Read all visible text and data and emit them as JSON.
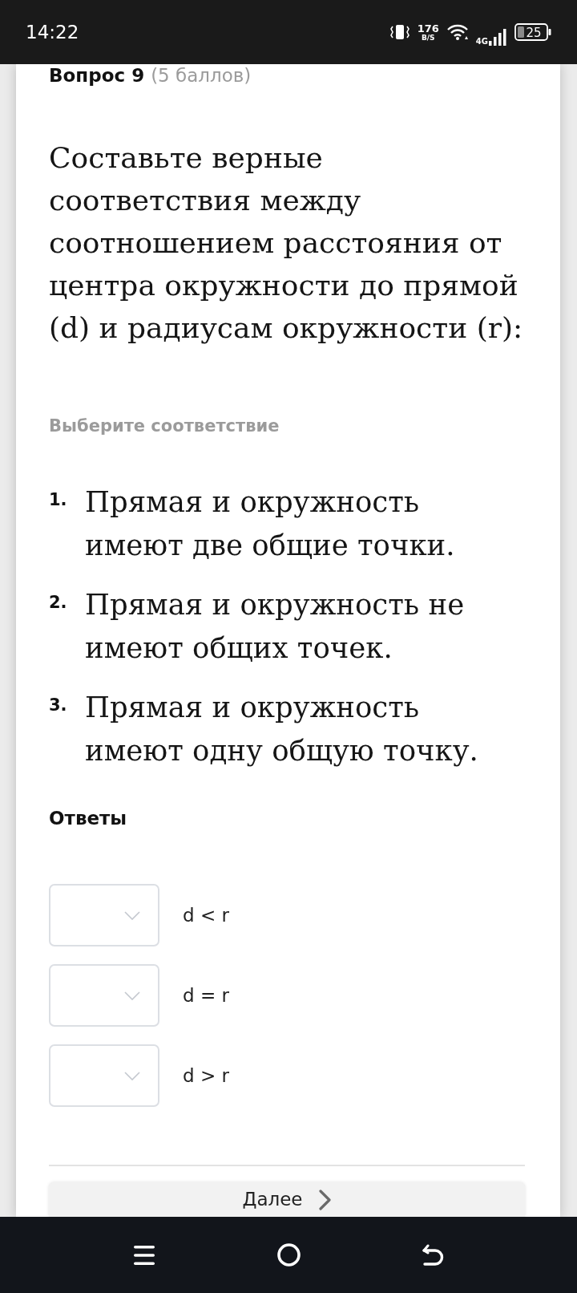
{
  "status_bar": {
    "time": "14:22",
    "network_speed": "176",
    "network_speed_unit": "B/S",
    "network_type": "4G",
    "battery": "25"
  },
  "question": {
    "title": "Вопрос 9",
    "points": "(5 баллов)",
    "text": "Составьте верные соответствия между соотношением расстояния от центра окружности до прямой (d) и радиусам окружности (r):"
  },
  "instruction": "Выберите соответствие",
  "statements": [
    {
      "number": "1.",
      "text": "Прямая и окружность имеют две общие точки."
    },
    {
      "number": "2.",
      "text": "Прямая и окружность не имеют общих точек."
    },
    {
      "number": "3.",
      "text": "Прямая и окружность имеют одну общую точку."
    }
  ],
  "answers": {
    "heading": "Ответы",
    "items": [
      {
        "label": "d < r"
      },
      {
        "label": "d = r"
      },
      {
        "label": "d > r"
      }
    ]
  },
  "next_button": {
    "label": "Далее"
  }
}
